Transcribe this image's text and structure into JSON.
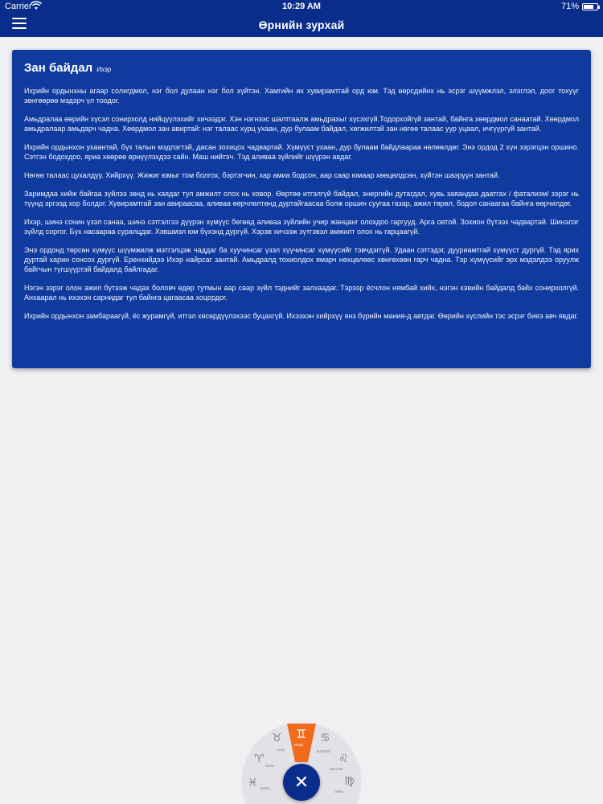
{
  "status_bar": {
    "carrier": "Carrier",
    "time": "10:29 AM",
    "battery": "71%"
  },
  "nav": {
    "title": "Өрнийн зурхай",
    "menu_icon": "hamburger-menu-icon"
  },
  "card": {
    "title": "Зан байдал",
    "sign": "Ихэр",
    "paragraphs": [
      "Ихрийн ордынхны агаар солигдмол, нэг бол дулаан нэг бол хүйтэн. Хамгийн их хувирамтгай орд юм. Тэд өөрсдийнх нь эсрэг шүүмжлэл, элэглэл, доог тохуүг зөнгөөрөө мэдэрч үл тоодог.",
      "Амьдралаа өөрийн хүсэл сонирхолд нийцүүлэхийг хичээдэг. Хэн нэгнээс шалтгаалж амьдрахыг хүсэхгүй.Тодорхойгүй зантай, байнга хөөрдмол санаатай. Хөөрдмол амьдралаар амьдарч чадна. Хөөрдмол зан авиртай: нэг талаас хурц ухаан, дур булаам байдал, хөгжилтэй зан нөгөө талаас уур уцаал, ичгүүргүй зантай.",
      "Ихрийн ордынхон ухаантай, бүх талын мэдлэгтэй, дасан зохицох чадвартай. Хүмүүст ухаан, дур булаам байдлаараа нөлөөлдөг. Энэ ордод 2 хүн зэрэгцэн оршино. Сэтгэн бодохдоо, яриа хөөрөө өрнүүлэхдээ сайн. Маш нийтэч. Тэд аливаа зүйлийг шүүрэн авдаг.",
      "Нөгөө талаас цухалдуу. Хийрхүү. Жижиг юмыг том болгох, бэртэгчин, хар амиа бодсон, аар саар юмаар хөөцөлдсөн, хүйтэн шаэруун зантай.",
      "Заримдаа хийж байгаа зүйлээ зөнд нь хаядаг тул амжилт олох нь ховор. Өөртөө итгэлгүй байдал, энергийн дутагдал, хувь заяандаа даатгах / фатализм/ зэрэг нь түүнд эргээд хор болдог. Хувирамтгай зан авираасаа, аливаа өөрчлөлтөнд дуртайгаасаа болж оршин суугаа газар, ажил төрөл, бодол санаагаа байнга өөрчилдөг.",
      "Ихэр, шинэ сонин үзэл санаа, шинэ сэтгэлгээ дүүрэн хүмүүс бөгөөд аливаа зүйлийн учир жанцанг олохдоо гаргууд. Арга овтой. Зохион бүтээх чадвартай. Шинэлэг зүйлд соргог. Бүх насаараа суралцдаг. Хэвшмэл юм бүхэнд дургүй. Хэрэв хичээж зүтгэвэл амжилт олох нь гарцаагүй.",
      "Энэ ордонд төрсөн хүмүүс шүүмжилж мэтгэлцэж чаддаг ба хуучинсаг үзэл хүүчинсаг хүмүүсийг тэвчдэггүй. Удаан сэтгэдэг, дууриамтгай хүмүүст дургүй. Тэд ярих дуртай харин сонсох дургүй. Еренхийдээ Ихэр найрсаг зантай. Амьдралд тохиолдох ямарч нөхцөлөөс хөнгөхөөн гарч чадна. Тэр хүмүүсийг эрх мэдэлдээ оруулж байгчын түгшүүртэй байдалд байлгадаг.",
      "Нэгэн зэрэг олон ажил бүтээж чадах боловч өдөр тутмын аар саар зүйл тэднийг залхаадаг. Тэрээр ёсчлон нямбай хийх, нэгэн хэвийн байдалд байх сонирхолгүй. Анхаарал нь ихэхэн сарнидаг тул байнга цагаасаа хоцордог.",
      "Ихрийн ордынхон замбараагүй, ёс журамгүй, итгэл хөсөрдүүлэхээс буцахгүй. Ихээхэн хийрхүү янз бүрийн мания-д автдаг. Өөрийн хүслийн тэс эсрэг биеэ авч явдаг."
    ]
  },
  "zodiac_wheel": {
    "active_sign": "ихэр",
    "items": [
      {
        "symbol": "♉",
        "label": "үхэр"
      },
      {
        "symbol": "♈",
        "label": "хонь"
      },
      {
        "symbol": "♓",
        "label": "загас"
      },
      {
        "symbol": "♊",
        "label": "ихэр"
      },
      {
        "symbol": "♋",
        "label": "мэлхий"
      },
      {
        "symbol": "♌",
        "label": "арслан"
      },
      {
        "symbol": "♍",
        "label": "охин"
      }
    ],
    "close_label": "✕",
    "accent_color": "#f26a1b"
  },
  "colors": {
    "primary": "#0a2d8c",
    "card": "#103b9e",
    "background": "#f0f0f2"
  }
}
